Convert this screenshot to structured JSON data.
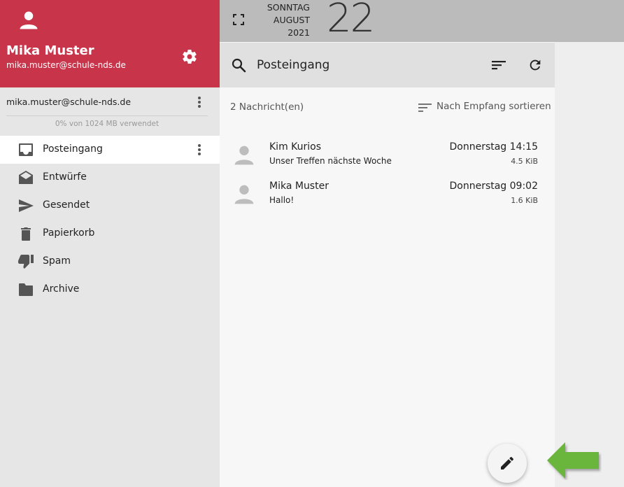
{
  "profile": {
    "name": "Mika Muster",
    "email": "mika.muster@schule-nds.de"
  },
  "account": {
    "email": "mika.muster@schule-nds.de",
    "quota": "0% von 1024 MB verwendet"
  },
  "folders": [
    {
      "label": "Posteingang",
      "icon": "inbox-icon",
      "active": true
    },
    {
      "label": "Entwürfe",
      "icon": "drafts-icon"
    },
    {
      "label": "Gesendet",
      "icon": "send-icon"
    },
    {
      "label": "Papierkorb",
      "icon": "trash-icon"
    },
    {
      "label": "Spam",
      "icon": "thumb-down-icon"
    },
    {
      "label": "Archive",
      "icon": "folder-icon"
    }
  ],
  "date": {
    "weekday": "SONNTAG",
    "month": "AUGUST",
    "year": "2021",
    "day": "22"
  },
  "toolbar": {
    "title": "Posteingang"
  },
  "list": {
    "count": "2 Nachricht(en)",
    "sort_label": "Nach Empfang sortieren",
    "messages": [
      {
        "sender": "Kim Kurios",
        "subject": "Unser Treffen nächste Woche",
        "date": "Donnerstag 14:15",
        "size": "4.5 KiB"
      },
      {
        "sender": "Mika Muster",
        "subject": "Hallo!",
        "date": "Donnerstag 09:02",
        "size": "1.6 KiB"
      }
    ]
  },
  "colors": {
    "brand": "#c8344a",
    "arrow": "#6ab53a"
  }
}
